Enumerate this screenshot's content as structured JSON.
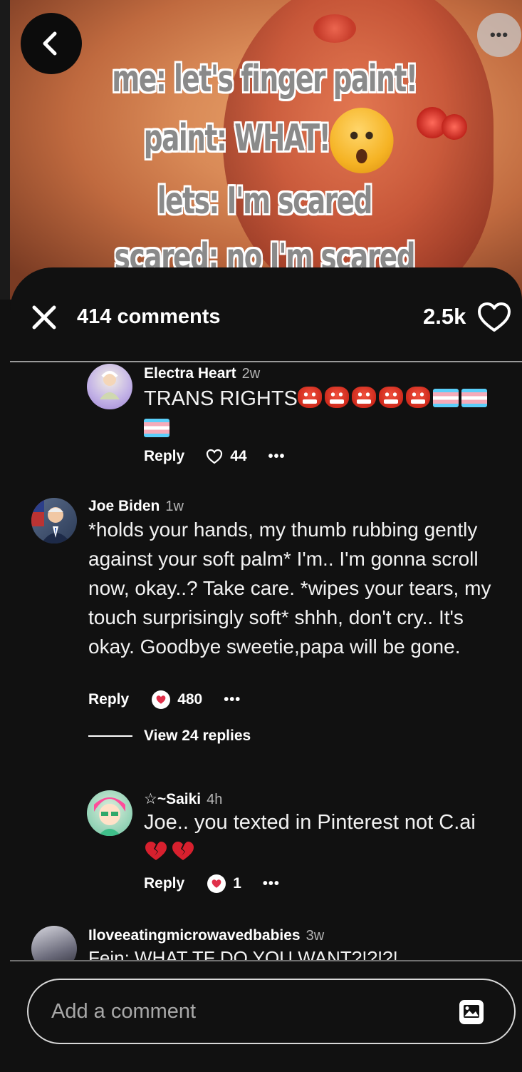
{
  "pin": {
    "meme_lines": [
      "me: let's finger paint!",
      "paint: WHAT!",
      "lets: I'm scared",
      "scared: no I'm scared"
    ]
  },
  "icons": {
    "back": "chevron-left-icon",
    "more": "ellipsis-icon",
    "close": "close-icon",
    "like": "heart-outline-icon",
    "attach": "image-icon"
  },
  "header": {
    "comment_count": "414 comments",
    "like_count": "2.5k"
  },
  "comments": [
    {
      "name": "Electra Heart",
      "time": "2w",
      "text": "TRANS RIGHTS",
      "reply_label": "Reply",
      "likes": "44"
    },
    {
      "name": "Joe Biden",
      "time": "1w",
      "text": "*holds your hands, my thumb rubbing gently against your soft palm* I'm.. I'm gonna scroll now, okay..? Take care. *wipes your tears, my touch surprisingly soft* shhh, don't cry.. It's okay. Goodbye sweetie,papa will be gone.",
      "reply_label": "Reply",
      "likes": "480",
      "view_replies": "View 24 replies"
    },
    {
      "name": "☆~Saiki",
      "time": "4h",
      "text": "Joe.. you texted in Pinterest not C.ai",
      "reply_label": "Reply",
      "likes": "1"
    },
    {
      "name": "Iloveeatingmicrowavedbabies",
      "time": "3w",
      "text": "Fein: WHAT TF DO YOU WANT?!?!?!"
    }
  ],
  "composer": {
    "placeholder": "Add a comment"
  },
  "colors": {
    "background": "#111111",
    "reaction_red": "#e0304a",
    "trans_blue": "#5bcffa",
    "trans_pink": "#f5abb9"
  }
}
